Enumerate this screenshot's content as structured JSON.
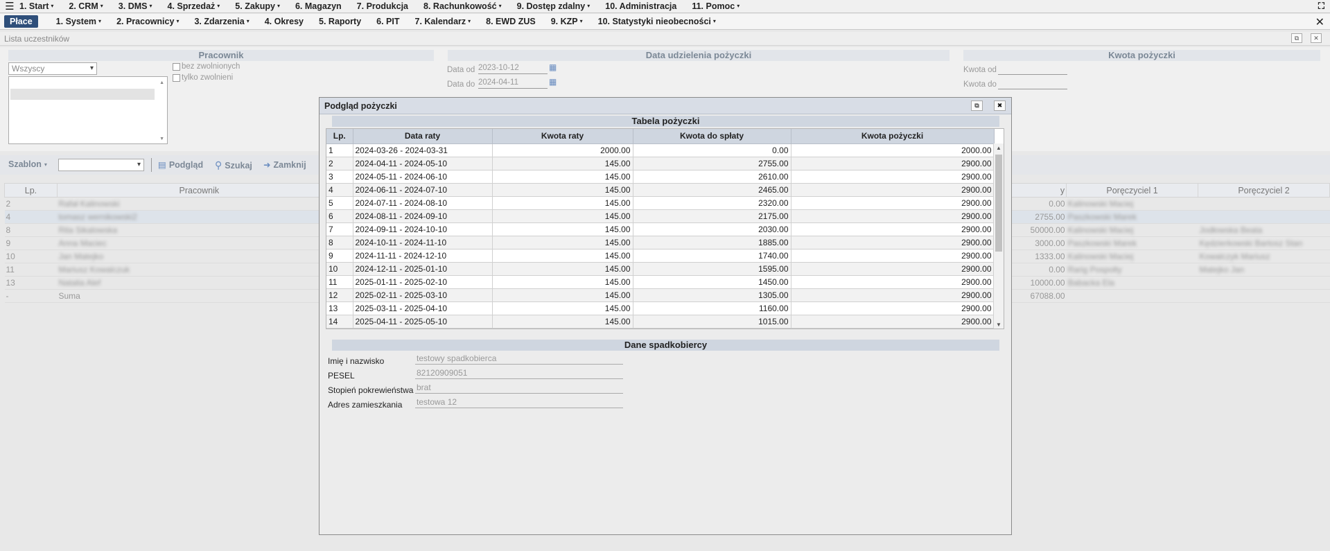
{
  "topbar": {
    "hamburger_icon": "hamburger-icon",
    "items": [
      {
        "label": "1. Start",
        "dd": true
      },
      {
        "label": "2. CRM",
        "dd": true
      },
      {
        "label": "3. DMS",
        "dd": true
      },
      {
        "label": "4. Sprzedaż",
        "dd": true
      },
      {
        "label": "5. Zakupy",
        "dd": true
      },
      {
        "label": "6. Magazyn",
        "dd": false
      },
      {
        "label": "7. Produkcja",
        "dd": false
      },
      {
        "label": "8. Rachunkowość",
        "dd": true
      },
      {
        "label": "9. Dostęp zdalny",
        "dd": true
      },
      {
        "label": "10. Administracja",
        "dd": false
      },
      {
        "label": "11. Pomoc",
        "dd": true
      }
    ],
    "fullscreen_icon": "fullscreen-icon"
  },
  "subbar": {
    "active_tab": "Płace",
    "items": [
      {
        "label": "1. System",
        "dd": true
      },
      {
        "label": "2. Pracownicy",
        "dd": true
      },
      {
        "label": "3. Zdarzenia",
        "dd": true
      },
      {
        "label": "4. Okresy",
        "dd": false
      },
      {
        "label": "5. Raporty",
        "dd": false
      },
      {
        "label": "6. PIT",
        "dd": false
      },
      {
        "label": "7. Kalendarz",
        "dd": true
      },
      {
        "label": "8. EWD ZUS",
        "dd": false
      },
      {
        "label": "9. KZP",
        "dd": true
      },
      {
        "label": "10. Statystyki nieobecności",
        "dd": true
      }
    ],
    "close_label": "✕"
  },
  "page": {
    "title": "Lista uczestników"
  },
  "filters": {
    "pracownik": {
      "header": "Pracownik",
      "select_value": "Wszyscy",
      "checkbox_1": "bez zwolnionych",
      "checkbox_2": "tylko zwolnieni"
    },
    "data": {
      "header": "Data udzielenia pożyczki",
      "from_label": "Data od",
      "from_value": "2023-10-12",
      "to_label": "Data do",
      "to_value": "2024-04-11"
    },
    "kwota": {
      "header": "Kwota pożyczki",
      "from_label": "Kwota od",
      "to_label": "Kwota do"
    }
  },
  "toolbar": {
    "szablon_label": "Szablon",
    "podglad_label": "Podgląd",
    "szukaj_label": "Szukaj",
    "zamknij_label": "Zamknij"
  },
  "main_table": {
    "headers": {
      "lp": "Lp.",
      "pracownik": "Pracownik",
      "y": "y",
      "p1": "Poręczyciel 1",
      "p2": "Poręczyciel 2"
    },
    "rows": [
      {
        "lp": "2",
        "name": "Rafał Kalinowski",
        "amount": "0.00",
        "p1": "Kalinowski Maciej",
        "p2": ""
      },
      {
        "lp": "4",
        "name": "tomasz wernikowski2",
        "amount": "2755.00",
        "p1": "Paszkowski Marek",
        "p2": ""
      },
      {
        "lp": "8",
        "name": "Rita Sikalowska",
        "amount": "50000.00",
        "p1": "Kalinowski Maciej",
        "p2": "Jodłowska Beata"
      },
      {
        "lp": "9",
        "name": "Anna Maciec",
        "amount": "3000.00",
        "p1": "Paszkowski Marek",
        "p2": "Kędzierkowski Bartosz Stan"
      },
      {
        "lp": "10",
        "name": "Jan Matejko",
        "amount": "1333.00",
        "p1": "Kalinowski Maciej",
        "p2": "Kowalczyk Mariusz"
      },
      {
        "lp": "11",
        "name": "Mariusz Kowalczuk",
        "amount": "0.00",
        "p1": "Rarig Pospolty",
        "p2": "Matejko Jan"
      },
      {
        "lp": "13",
        "name": "Natalia Alef",
        "amount": "10000.00",
        "p1": "Babacka Ela",
        "p2": ""
      },
      {
        "lp": "-",
        "name": "Suma",
        "amount": "67088.00",
        "p1": "",
        "p2": ""
      }
    ]
  },
  "modal": {
    "title": "Podgląd pożyczki",
    "table_title": "Tabela pożyczki",
    "headers": {
      "lp": "Lp.",
      "data": "Data raty",
      "kwota_raty": "Kwota raty",
      "do_splaty": "Kwota do spłaty",
      "kwota_pozyczki": "Kwota pożyczki"
    },
    "rows": [
      {
        "lp": "1",
        "data": "2024-03-26 - 2024-03-31",
        "rata": "2000.00",
        "splata": "0.00",
        "pozyczka": "2000.00"
      },
      {
        "lp": "2",
        "data": "2024-04-11 - 2024-05-10",
        "rata": "145.00",
        "splata": "2755.00",
        "pozyczka": "2900.00"
      },
      {
        "lp": "3",
        "data": "2024-05-11 - 2024-06-10",
        "rata": "145.00",
        "splata": "2610.00",
        "pozyczka": "2900.00"
      },
      {
        "lp": "4",
        "data": "2024-06-11 - 2024-07-10",
        "rata": "145.00",
        "splata": "2465.00",
        "pozyczka": "2900.00"
      },
      {
        "lp": "5",
        "data": "2024-07-11 - 2024-08-10",
        "rata": "145.00",
        "splata": "2320.00",
        "pozyczka": "2900.00"
      },
      {
        "lp": "6",
        "data": "2024-08-11 - 2024-09-10",
        "rata": "145.00",
        "splata": "2175.00",
        "pozyczka": "2900.00"
      },
      {
        "lp": "7",
        "data": "2024-09-11 - 2024-10-10",
        "rata": "145.00",
        "splata": "2030.00",
        "pozyczka": "2900.00"
      },
      {
        "lp": "8",
        "data": "2024-10-11 - 2024-11-10",
        "rata": "145.00",
        "splata": "1885.00",
        "pozyczka": "2900.00"
      },
      {
        "lp": "9",
        "data": "2024-11-11 - 2024-12-10",
        "rata": "145.00",
        "splata": "1740.00",
        "pozyczka": "2900.00"
      },
      {
        "lp": "10",
        "data": "2024-12-11 - 2025-01-10",
        "rata": "145.00",
        "splata": "1595.00",
        "pozyczka": "2900.00"
      },
      {
        "lp": "11",
        "data": "2025-01-11 - 2025-02-10",
        "rata": "145.00",
        "splata": "1450.00",
        "pozyczka": "2900.00"
      },
      {
        "lp": "12",
        "data": "2025-02-11 - 2025-03-10",
        "rata": "145.00",
        "splata": "1305.00",
        "pozyczka": "2900.00"
      },
      {
        "lp": "13",
        "data": "2025-03-11 - 2025-04-10",
        "rata": "145.00",
        "splata": "1160.00",
        "pozyczka": "2900.00"
      },
      {
        "lp": "14",
        "data": "2025-04-11 - 2025-05-10",
        "rata": "145.00",
        "splata": "1015.00",
        "pozyczka": "2900.00"
      }
    ],
    "heir": {
      "title": "Dane spadkobiercy",
      "name_label": "Imię i nazwisko",
      "name_value": "testowy spadkobierca",
      "pesel_label": "PESEL",
      "pesel_value": "82120909051",
      "rel_label": "Stopień pokrewieństwa",
      "rel_value": "brat",
      "addr_label": "Adres zamieszkania",
      "addr_value": "testowa 12"
    }
  }
}
